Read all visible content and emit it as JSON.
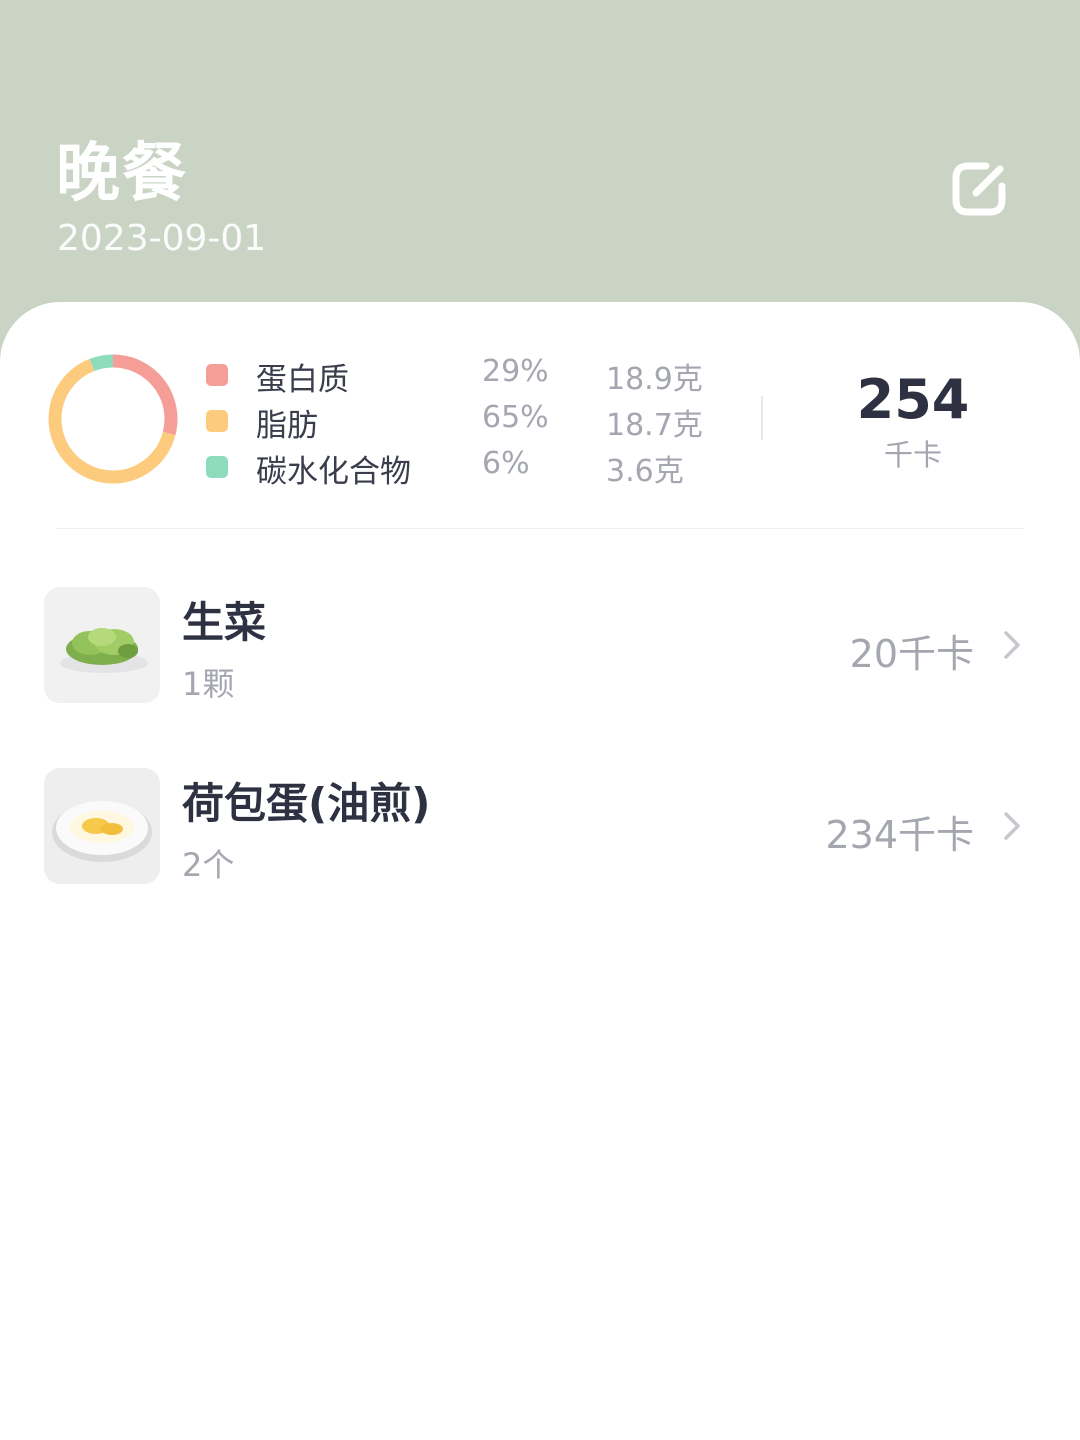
{
  "header": {
    "title": "晚餐",
    "date": "2023-09-01",
    "edit_icon": "edit-square-icon"
  },
  "summary": {
    "macros": [
      {
        "name": "蛋白质",
        "percent": "29%",
        "grams": "18.9克",
        "color": "#f59e98",
        "fraction": 0.29
      },
      {
        "name": "脂肪",
        "percent": "65%",
        "grams": "18.7克",
        "color": "#fdcb7e",
        "fraction": 0.65
      },
      {
        "name": "碳水化合物",
        "percent": "6%",
        "grams": "3.6克",
        "color": "#8fdcbd",
        "fraction": 0.06
      }
    ],
    "total_kcal": "254",
    "kcal_unit": "千卡"
  },
  "foods": [
    {
      "name": "生菜",
      "portion": "1颗",
      "kcal": "20千卡",
      "thumb": "lettuce-thumbnail"
    },
    {
      "name": "荷包蛋(油煎)",
      "portion": "2个",
      "kcal": "234千卡",
      "thumb": "fried-egg-thumbnail"
    }
  ],
  "colors": {
    "header_bg": "#c9d4c4",
    "card_bg": "#ffffff",
    "primary_text": "#2d3142",
    "secondary_text": "#a4a6b0"
  }
}
